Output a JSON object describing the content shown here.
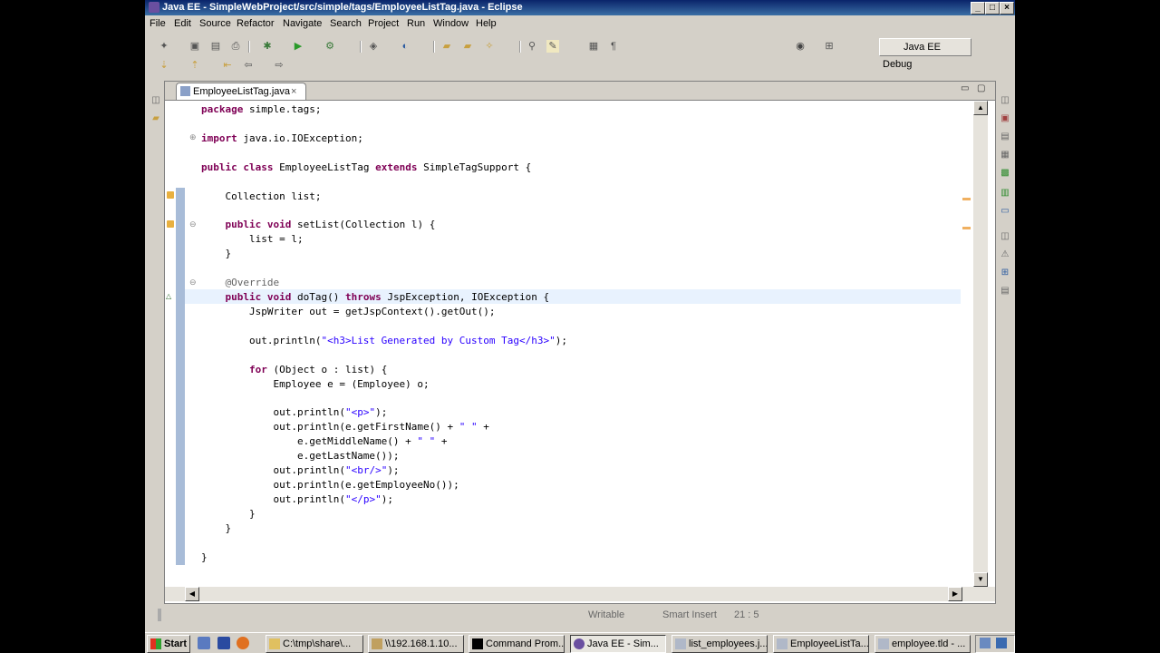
{
  "window": {
    "title": "Java EE - SimpleWebProject/src/simple/tags/EmployeeListTag.java - Eclipse",
    "controls": {
      "minimize": "_",
      "maximize": "□",
      "close": "×"
    }
  },
  "menu": [
    "File",
    "Edit",
    "Source",
    "Refactor",
    "Navigate",
    "Search",
    "Project",
    "Run",
    "Window",
    "Help"
  ],
  "perspectives": {
    "active": "Java EE",
    "other": "Debug"
  },
  "editor": {
    "tab_label": "EmployeeListTag.java",
    "close_glyph": "×",
    "code_lines": [
      [
        {
          "t": "package",
          "c": "kw"
        },
        {
          "t": " simple.tags;"
        }
      ],
      [],
      [
        {
          "t": "import",
          "c": "kw"
        },
        {
          "t": " java.io.IOException;"
        }
      ],
      [],
      [
        {
          "t": "public",
          "c": "kw"
        },
        {
          "t": " "
        },
        {
          "t": "class",
          "c": "kw"
        },
        {
          "t": " EmployeeListTag "
        },
        {
          "t": "extends",
          "c": "kw"
        },
        {
          "t": " SimpleTagSupport {"
        }
      ],
      [],
      [
        {
          "t": "    Collection list;"
        }
      ],
      [],
      [
        {
          "t": "    "
        },
        {
          "t": "public",
          "c": "kw"
        },
        {
          "t": " "
        },
        {
          "t": "void",
          "c": "kw"
        },
        {
          "t": " setList(Collection l) {"
        }
      ],
      [
        {
          "t": "        list = l;"
        }
      ],
      [
        {
          "t": "    }"
        }
      ],
      [],
      [
        {
          "t": "    "
        },
        {
          "t": "@Override",
          "c": "ann"
        }
      ],
      [
        {
          "t": "    "
        },
        {
          "t": "public",
          "c": "kw"
        },
        {
          "t": " "
        },
        {
          "t": "void",
          "c": "kw"
        },
        {
          "t": " doTag() "
        },
        {
          "t": "throws",
          "c": "kw"
        },
        {
          "t": " JspException, IOException {"
        }
      ],
      [
        {
          "t": "        JspWriter out = getJspContext().getOut();"
        }
      ],
      [],
      [
        {
          "t": "        out.println("
        },
        {
          "t": "\"<h3>List Generated by Custom Tag</h3>\"",
          "c": "str"
        },
        {
          "t": ");"
        }
      ],
      [],
      [
        {
          "t": "        "
        },
        {
          "t": "for",
          "c": "kw"
        },
        {
          "t": " (Object o : list) {"
        }
      ],
      [
        {
          "t": "            Employee e = (Employee) o;"
        }
      ],
      [],
      [
        {
          "t": "            out.println("
        },
        {
          "t": "\"<p>\"",
          "c": "str"
        },
        {
          "t": ");"
        }
      ],
      [
        {
          "t": "            out.println(e.getFirstName() + "
        },
        {
          "t": "\" \"",
          "c": "str"
        },
        {
          "t": " +"
        }
      ],
      [
        {
          "t": "                e.getMiddleName() + "
        },
        {
          "t": "\" \"",
          "c": "str"
        },
        {
          "t": " +"
        }
      ],
      [
        {
          "t": "                e.getLastName());"
        }
      ],
      [
        {
          "t": "            out.println("
        },
        {
          "t": "\"<br/>\"",
          "c": "str"
        },
        {
          "t": ");"
        }
      ],
      [
        {
          "t": "            out.println(e.getEmployeeNo());"
        }
      ],
      [
        {
          "t": "            out.println("
        },
        {
          "t": "\"</p>\"",
          "c": "str"
        },
        {
          "t": ");"
        }
      ],
      [
        {
          "t": "        }"
        }
      ],
      [
        {
          "t": "    }"
        }
      ],
      [],
      [
        {
          "t": "}"
        }
      ]
    ]
  },
  "status": {
    "writable": "Writable",
    "insert_mode": "Smart Insert",
    "position": "21 : 5"
  },
  "taskbar": {
    "start": "Start",
    "tasks": [
      {
        "label": "C:\\tmp\\share\\...",
        "active": false
      },
      {
        "label": "\\\\192.168.1.10...",
        "active": false
      },
      {
        "label": "Command Prom...",
        "active": false
      },
      {
        "label": "Java EE - Sim...",
        "active": true
      },
      {
        "label": "list_employees.j...",
        "active": false
      },
      {
        "label": "EmployeeListTa...",
        "active": false
      },
      {
        "label": "employee.tld - ...",
        "active": false
      }
    ]
  }
}
